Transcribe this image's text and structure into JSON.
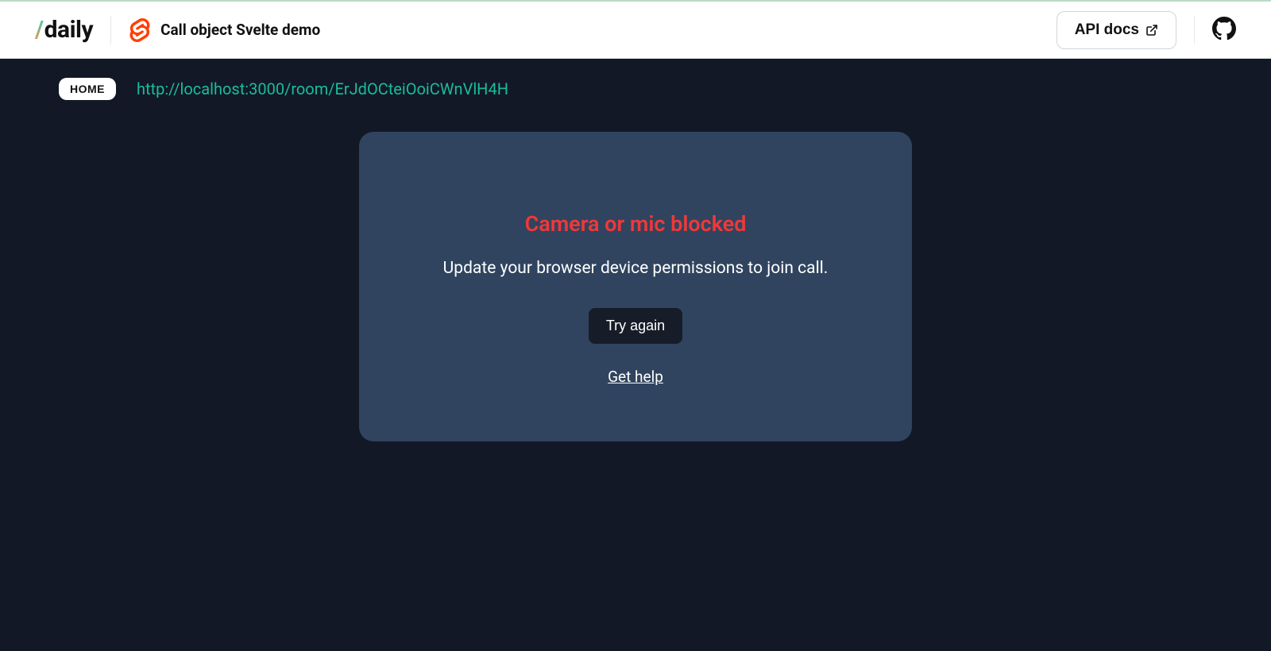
{
  "header": {
    "logo_text": "daily",
    "demo_title": "Call object Svelte demo",
    "api_docs_label": "API docs"
  },
  "nav": {
    "home_label": "HOME",
    "room_url": "http://localhost:3000/room/ErJdOCteiOoiCWnVlH4H"
  },
  "error_card": {
    "title": "Camera or mic blocked",
    "description": "Update your browser device permissions to join call.",
    "try_again_label": "Try again",
    "get_help_label": "Get help"
  },
  "colors": {
    "bg_dark": "#121826",
    "card_bg": "#30445f",
    "error_red": "#f13838",
    "accent_teal": "#1abc9c"
  }
}
